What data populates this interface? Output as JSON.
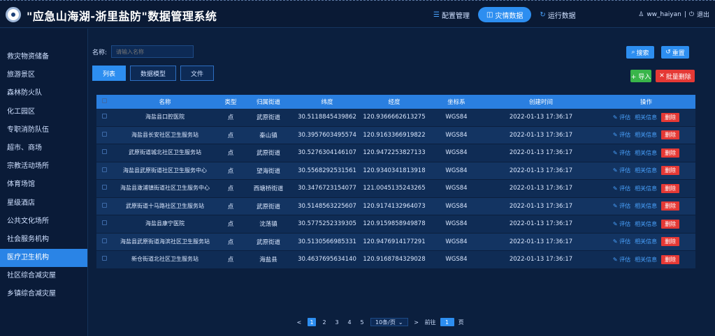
{
  "app": {
    "title": "\"应急山海湖-浙里盐防\"数据管理系统"
  },
  "top_nav": [
    {
      "label": "配置管理",
      "icon": "settings-icon",
      "active": false
    },
    {
      "label": "灾情数据",
      "icon": "data-icon",
      "active": true
    },
    {
      "label": "运行数据",
      "icon": "refresh-icon",
      "active": false
    }
  ],
  "user": {
    "name": "ww_haiyan",
    "logout": "退出"
  },
  "sidebar": {
    "items": [
      {
        "label": "救灾物资储备",
        "active": false
      },
      {
        "label": "旅游景区",
        "active": false
      },
      {
        "label": "森林防火队",
        "active": false
      },
      {
        "label": "化工园区",
        "active": false
      },
      {
        "label": "专职消防队伍",
        "active": false
      },
      {
        "label": "超市、商场",
        "active": false
      },
      {
        "label": "宗教活动场所",
        "active": false
      },
      {
        "label": "体育场馆",
        "active": false
      },
      {
        "label": "星级酒店",
        "active": false
      },
      {
        "label": "公共文化场所",
        "active": false
      },
      {
        "label": "社会服务机构",
        "active": false
      },
      {
        "label": "医疗卫生机构",
        "active": true
      },
      {
        "label": "社区综合减灾屋",
        "active": false
      },
      {
        "label": "乡镇综合减灾屋",
        "active": false
      }
    ]
  },
  "filter": {
    "label": "名称:",
    "placeholder": "请输入名称",
    "search_label": "搜索",
    "reset_label": "重置"
  },
  "actions": {
    "import_label": "+ 导入",
    "batch_delete_label": "批量删除"
  },
  "subtabs": [
    {
      "label": "列表",
      "active": true
    },
    {
      "label": "数据模型",
      "active": false
    },
    {
      "label": "文件",
      "active": false
    }
  ],
  "table": {
    "headers": [
      "",
      "名称",
      "类型",
      "归属街道",
      "纬度",
      "经度",
      "坐标系",
      "创建时间",
      "操作"
    ],
    "op_labels": {
      "edit": "评估",
      "detail": "相关信息",
      "delete": "删除"
    },
    "rows": [
      {
        "name": "海盐县口腔医院",
        "type": "点",
        "street": "武原街道",
        "lat": "30.5118845439862",
        "lng": "120.9366662613275",
        "crs": "WGS84",
        "created": "2022-01-13 17:36:17"
      },
      {
        "name": "海盐县长安社区卫生服务站",
        "type": "点",
        "street": "秦山镇",
        "lat": "30.3957603495574",
        "lng": "120.9163366919822",
        "crs": "WGS84",
        "created": "2022-01-13 17:36:17"
      },
      {
        "name": "武原街道城北社区卫生服务站",
        "type": "点",
        "street": "武原街道",
        "lat": "30.5276304146107",
        "lng": "120.9472253827133",
        "crs": "WGS84",
        "created": "2022-01-13 17:36:17"
      },
      {
        "name": "海盐县武原街道社区卫生服务中心",
        "type": "点",
        "street": "望海街道",
        "lat": "30.5568292531561",
        "lng": "120.9340341813918",
        "crs": "WGS84",
        "created": "2022-01-13 17:36:17"
      },
      {
        "name": "海盐县澉浦镇街道社区卫生服务中心",
        "type": "点",
        "street": "西塘桥街道",
        "lat": "30.3476723154077",
        "lng": "121.0045135243265",
        "crs": "WGS84",
        "created": "2022-01-13 17:36:17"
      },
      {
        "name": "武原街道十马路社区卫生服务站",
        "type": "点",
        "street": "武原街道",
        "lat": "30.5148563225607",
        "lng": "120.9174132964073",
        "crs": "WGS84",
        "created": "2022-01-13 17:36:17"
      },
      {
        "name": "海盐县康宁医院",
        "type": "点",
        "street": "沈荡镇",
        "lat": "30.5775252339305",
        "lng": "120.9159858949878",
        "crs": "WGS84",
        "created": "2022-01-13 17:36:17"
      },
      {
        "name": "海盐县武原街道海滨社区卫生服务站",
        "type": "点",
        "street": "武原街道",
        "lat": "30.5130566985331",
        "lng": "120.9476914177291",
        "crs": "WGS84",
        "created": "2022-01-13 17:36:17"
      },
      {
        "name": "新仓街道北社区卫生服务站",
        "type": "点",
        "street": "海盐县",
        "lat": "30.4637695634140",
        "lng": "120.9168784329028",
        "crs": "WGS84",
        "created": "2022-01-13 17:36:17"
      }
    ]
  },
  "pager": {
    "prev": "<",
    "pages": [
      "1",
      "2",
      "3",
      "4",
      "5"
    ],
    "active_page": "1",
    "next": ">",
    "page_size": "10条/页",
    "goto_label": "前往",
    "goto_value": "1",
    "goto_suffix": "页"
  },
  "colors": {
    "accent": "#2d8ef0",
    "header_bg": "#0a1a35",
    "page_bg": "#0b1f3e",
    "table_head": "#2a7fe0",
    "danger": "#e53935",
    "success": "#39b54a"
  }
}
